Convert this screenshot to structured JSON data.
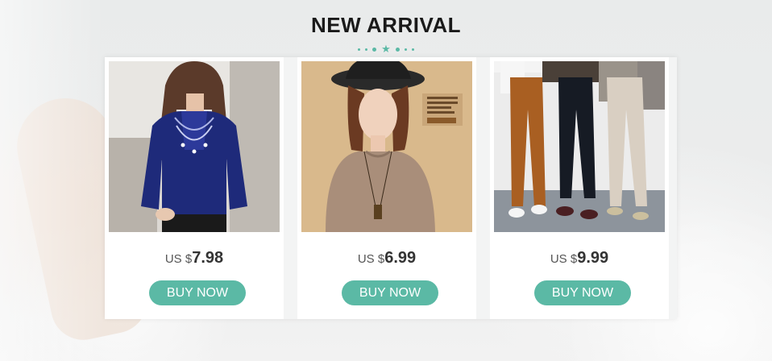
{
  "header": {
    "title": "NEW ARRIVAL"
  },
  "theme": {
    "accent": "#5bb9a5"
  },
  "products": [
    {
      "currency": "US $",
      "price": "7.98",
      "button": "BUY NOW",
      "image": "blue-lace-top-photo"
    },
    {
      "currency": "US $",
      "price": "6.99",
      "button": "BUY NOW",
      "image": "tan-sweater-photo"
    },
    {
      "currency": "US $",
      "price": "9.99",
      "button": "BUY NOW",
      "image": "cropped-pants-photo"
    }
  ]
}
